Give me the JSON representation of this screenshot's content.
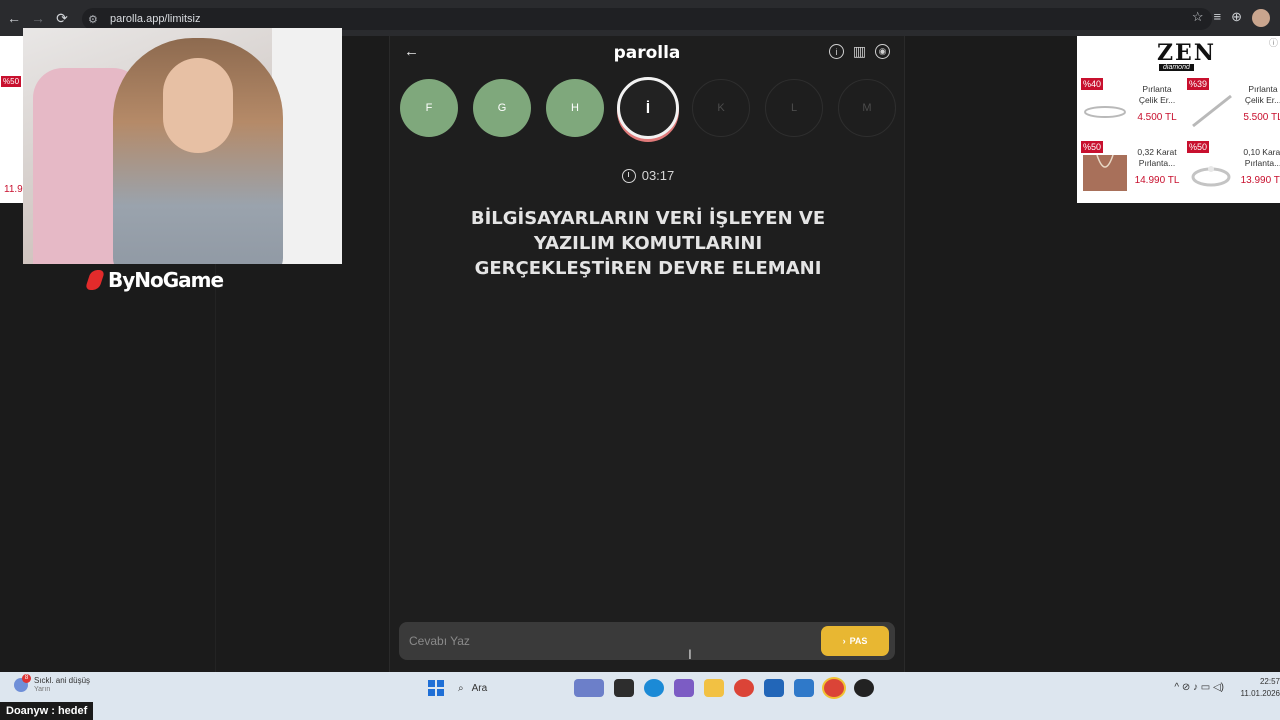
{
  "browser": {
    "url": "parolla.app/limitsiz",
    "back_icon": "←",
    "forward_icon": "→",
    "reload_icon": "⟳",
    "site_info_icon": "⚙",
    "star_icon": "☆",
    "media_icon": "≡",
    "extensions_icon": "⊕"
  },
  "stream": {
    "brand_text": "ByNoGame",
    "label": "Doanyw : hedef"
  },
  "side_strip": {
    "badge": "%50",
    "price": "11.9"
  },
  "app": {
    "title": "parolla",
    "back_icon": "←",
    "info_icon": "i",
    "stats_icon": "▥",
    "profile_icon": "◉",
    "letters": [
      {
        "letter": "F",
        "state": "done"
      },
      {
        "letter": "G",
        "state": "done"
      },
      {
        "letter": "H",
        "state": "done"
      },
      {
        "letter": "İ",
        "state": "active"
      },
      {
        "letter": "K",
        "state": "pending"
      },
      {
        "letter": "L",
        "state": "pending"
      },
      {
        "letter": "M",
        "state": "pending"
      }
    ],
    "timer": "03:17",
    "question_lines": [
      "BİLGİSAYARLARIN VERİ İŞLEYEN VE",
      "YAZILIM KOMUTLARINI",
      "GERÇEKLEŞTİREN DEVRE ELEMANI"
    ],
    "answer_placeholder": "Cevabı Yaz",
    "pass_label": "PAS",
    "pass_icon": "›"
  },
  "ad": {
    "brand": "ZEN",
    "brand_sub": "diamond",
    "info": "ⓘ",
    "items": [
      {
        "badge": "%40",
        "name": "Pırlanta Çelik Er...",
        "price": "4.500 TL"
      },
      {
        "badge": "%39",
        "name": "Pırlanta Çelik Er...",
        "price": "5.500 TL"
      },
      {
        "badge": "%50",
        "name": "0,32 Karat Pırlanta...",
        "price": "14.990 TL"
      },
      {
        "badge": "%50",
        "name": "0,10 Karat Pırlanta...",
        "price": "13.990 TL"
      }
    ]
  },
  "taskbar": {
    "weather_title": "Sıckl. ani düşüş",
    "weather_sub": "Yarın",
    "weather_count": "8",
    "search_placeholder": "Ara",
    "search_icon": "⌕",
    "tray_icons": "^  ⊘  ♪  ▭  ◁)",
    "time": "22:57",
    "date": "11.01.2026"
  },
  "colors": {
    "done": "#7fa87c",
    "pass": "#e8b732",
    "app_bg": "#1e1e1e"
  }
}
